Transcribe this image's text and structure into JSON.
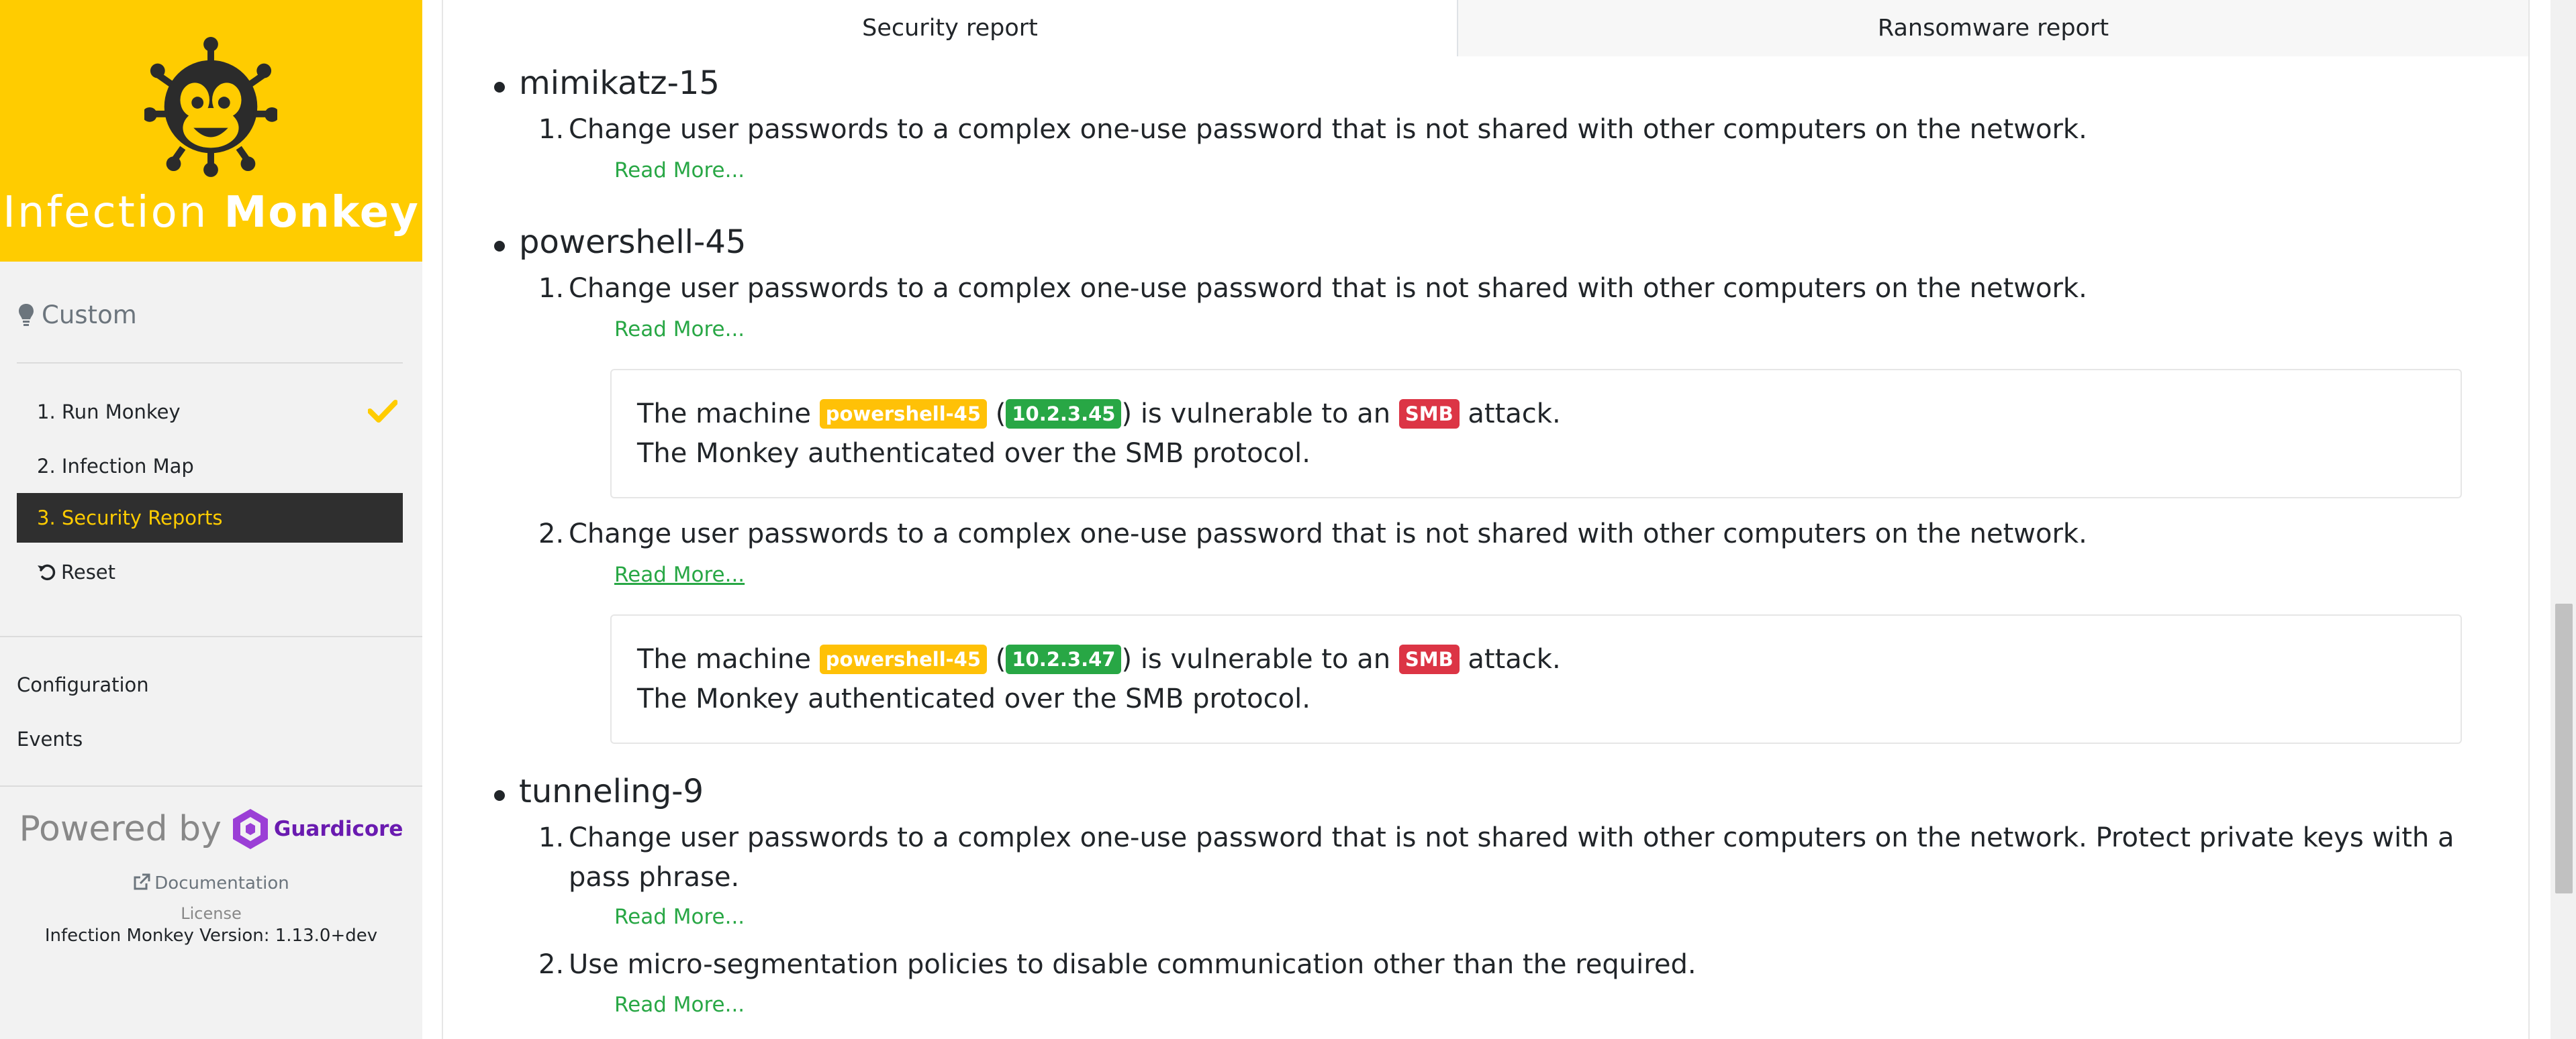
{
  "brand": {
    "title_light": "Infection",
    "title_bold": "Monkey"
  },
  "sidebar": {
    "mode": "Custom",
    "steps": [
      {
        "label": "1. Run Monkey",
        "done": true
      },
      {
        "label": "2. Infection Map",
        "done": false
      },
      {
        "label": "3. Security Reports",
        "active": true
      },
      {
        "label": "Reset"
      }
    ],
    "links": [
      "Configuration",
      "Events"
    ],
    "powered_by": "Powered by",
    "vendor": "Guardicore",
    "documentation": "Documentation",
    "license": "License",
    "version": "Infection Monkey Version: 1.13.0+dev"
  },
  "tabs": [
    {
      "label": "Security report",
      "active": true
    },
    {
      "label": "Ransomware report",
      "active": false
    }
  ],
  "report": {
    "machines": [
      {
        "name": "mimikatz-15",
        "recommendations": [
          {
            "num": "1.",
            "text": "Change user passwords to a complex one-use password that is not shared with other computers on the network.",
            "read_more": "Read More..."
          }
        ]
      },
      {
        "name": "powershell-45",
        "recommendations": [
          {
            "num": "1.",
            "text": "Change user passwords to a complex one-use password that is not shared with other computers on the network.",
            "read_more": "Read More...",
            "issue": {
              "prefix": "The machine",
              "machine": "powershell-45",
              "ip": "10.2.3.45",
              "middle": "is vulnerable to an",
              "attack": "SMB",
              "suffix": "attack.",
              "detail": "The Monkey authenticated over the SMB protocol."
            }
          },
          {
            "num": "2.",
            "text": "Change user passwords to a complex one-use password that is not shared with other computers on the network.",
            "read_more": "Read More...",
            "issue": {
              "prefix": "The machine",
              "machine": "powershell-45",
              "ip": "10.2.3.47",
              "middle": "is vulnerable to an",
              "attack": "SMB",
              "suffix": "attack.",
              "detail": "The Monkey authenticated over the SMB protocol."
            }
          }
        ]
      },
      {
        "name": "tunneling-9",
        "recommendations": [
          {
            "num": "1.",
            "text": "Change user passwords to a complex one-use password that is not shared with other computers on the network. Protect private keys with a pass phrase.",
            "read_more": "Read More..."
          },
          {
            "num": "2.",
            "text": "Use micro-segmentation policies to disable communication other than the required.",
            "read_more": "Read More..."
          }
        ]
      }
    ]
  },
  "colors": {
    "brand_yellow": "#ffcc00",
    "active_nav_bg": "#2f2f2f",
    "link_green": "#28a745",
    "badge_warning": "#ffc107",
    "badge_success": "#28a745",
    "badge_danger": "#dc3545",
    "vendor_purple": "#6a1bb0"
  },
  "icons": [
    "monkey-logo",
    "lightbulb-icon",
    "check-icon",
    "undo-icon",
    "guardicore-logo",
    "external-link-icon"
  ]
}
